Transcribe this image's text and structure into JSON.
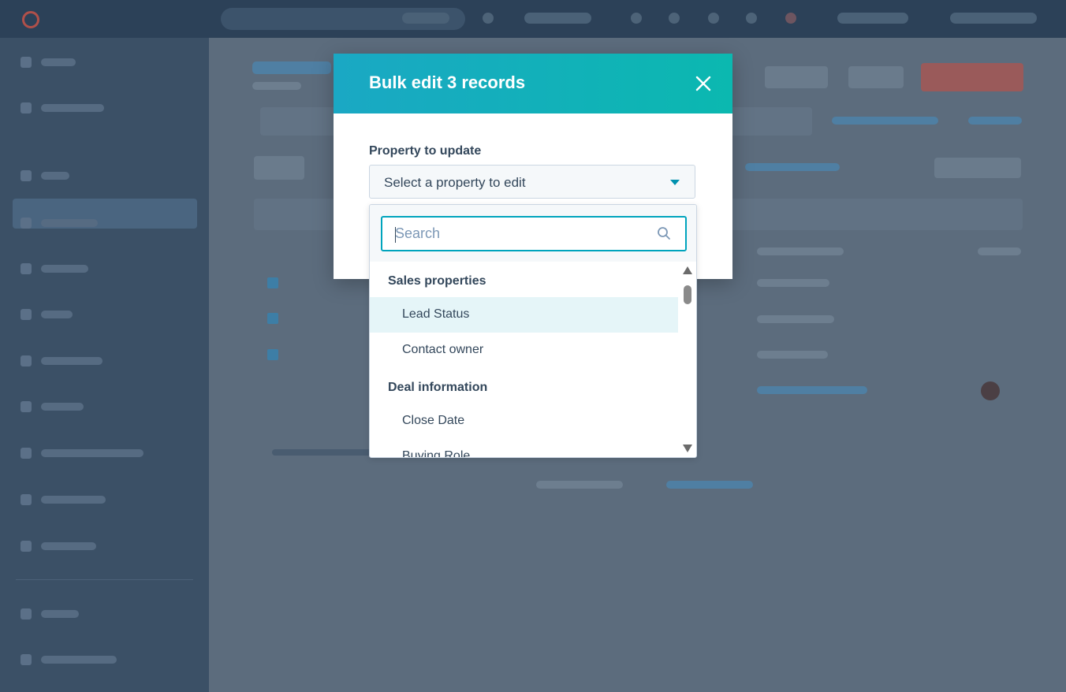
{
  "modal": {
    "title": "Bulk edit 3 records",
    "field_label": "Property to update",
    "select_placeholder": "Select a property to edit"
  },
  "dropdown": {
    "search_placeholder": "Search",
    "groups": [
      {
        "label": "Sales properties",
        "options": [
          "Lead Status",
          "Contact owner"
        ]
      },
      {
        "label": "Deal information",
        "options": [
          "Close Date",
          "Buying Role"
        ]
      }
    ],
    "highlighted_option": "Lead Status"
  },
  "colors": {
    "header_gradient_start": "#1aa8c4",
    "header_gradient_end": "#0bb8b0",
    "accent": "#00a4bd",
    "text": "#33475b",
    "highlight": "#e5f5f8"
  },
  "icons": [
    "close-icon",
    "chevron-down-icon",
    "search-icon",
    "scroll-up-icon",
    "scroll-down-icon"
  ]
}
